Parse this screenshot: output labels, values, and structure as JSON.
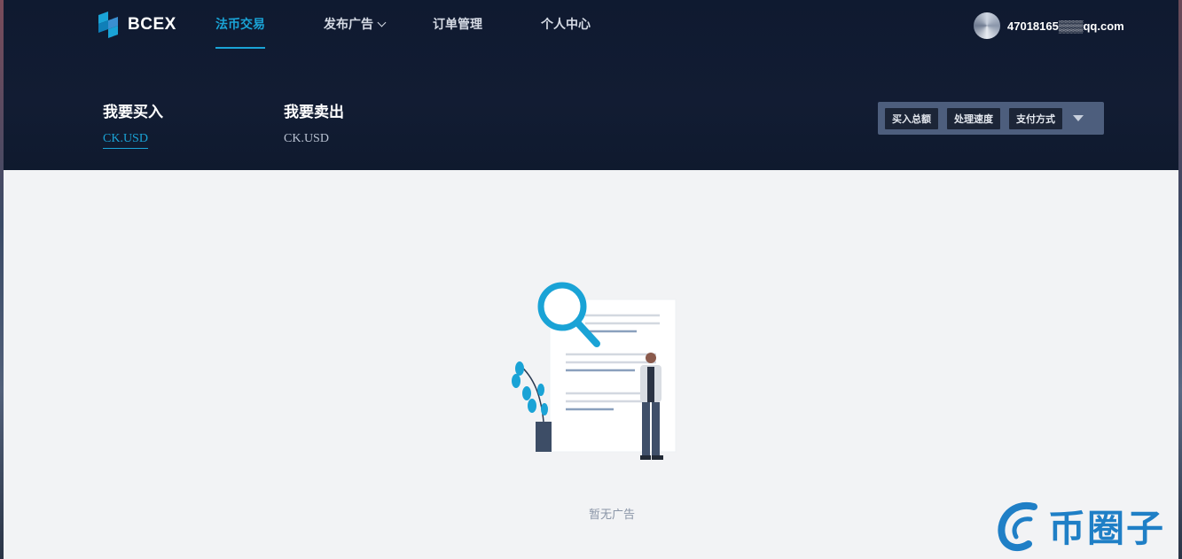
{
  "brand": {
    "name": "BCEX",
    "logo_icon": "bcex-logo-icon"
  },
  "nav": {
    "items": [
      {
        "label": "法币交易",
        "active": true
      },
      {
        "label": "发布广告",
        "has_dropdown": true
      },
      {
        "label": "订单管理"
      },
      {
        "label": "个人中心"
      }
    ]
  },
  "user": {
    "email": "47018165▒▒▒qq.com",
    "avatar_icon": "avatar-icon"
  },
  "tabs": {
    "buy": {
      "title": "我要买入",
      "currency": "CK.USD",
      "active": true
    },
    "sell": {
      "title": "我要卖出",
      "currency": "CK.USD"
    }
  },
  "filters": {
    "items": [
      "买入总额",
      "处理速度",
      "支付方式"
    ],
    "toggle_icon": "caret-down-icon"
  },
  "empty_state": {
    "text": "暂无广告",
    "illustration": "search-document-illustration"
  },
  "watermark": {
    "text": "币圈子"
  },
  "colors": {
    "accent": "#1aa3d6",
    "header_bg": "#121c33",
    "content_bg": "#f2f3f5"
  }
}
